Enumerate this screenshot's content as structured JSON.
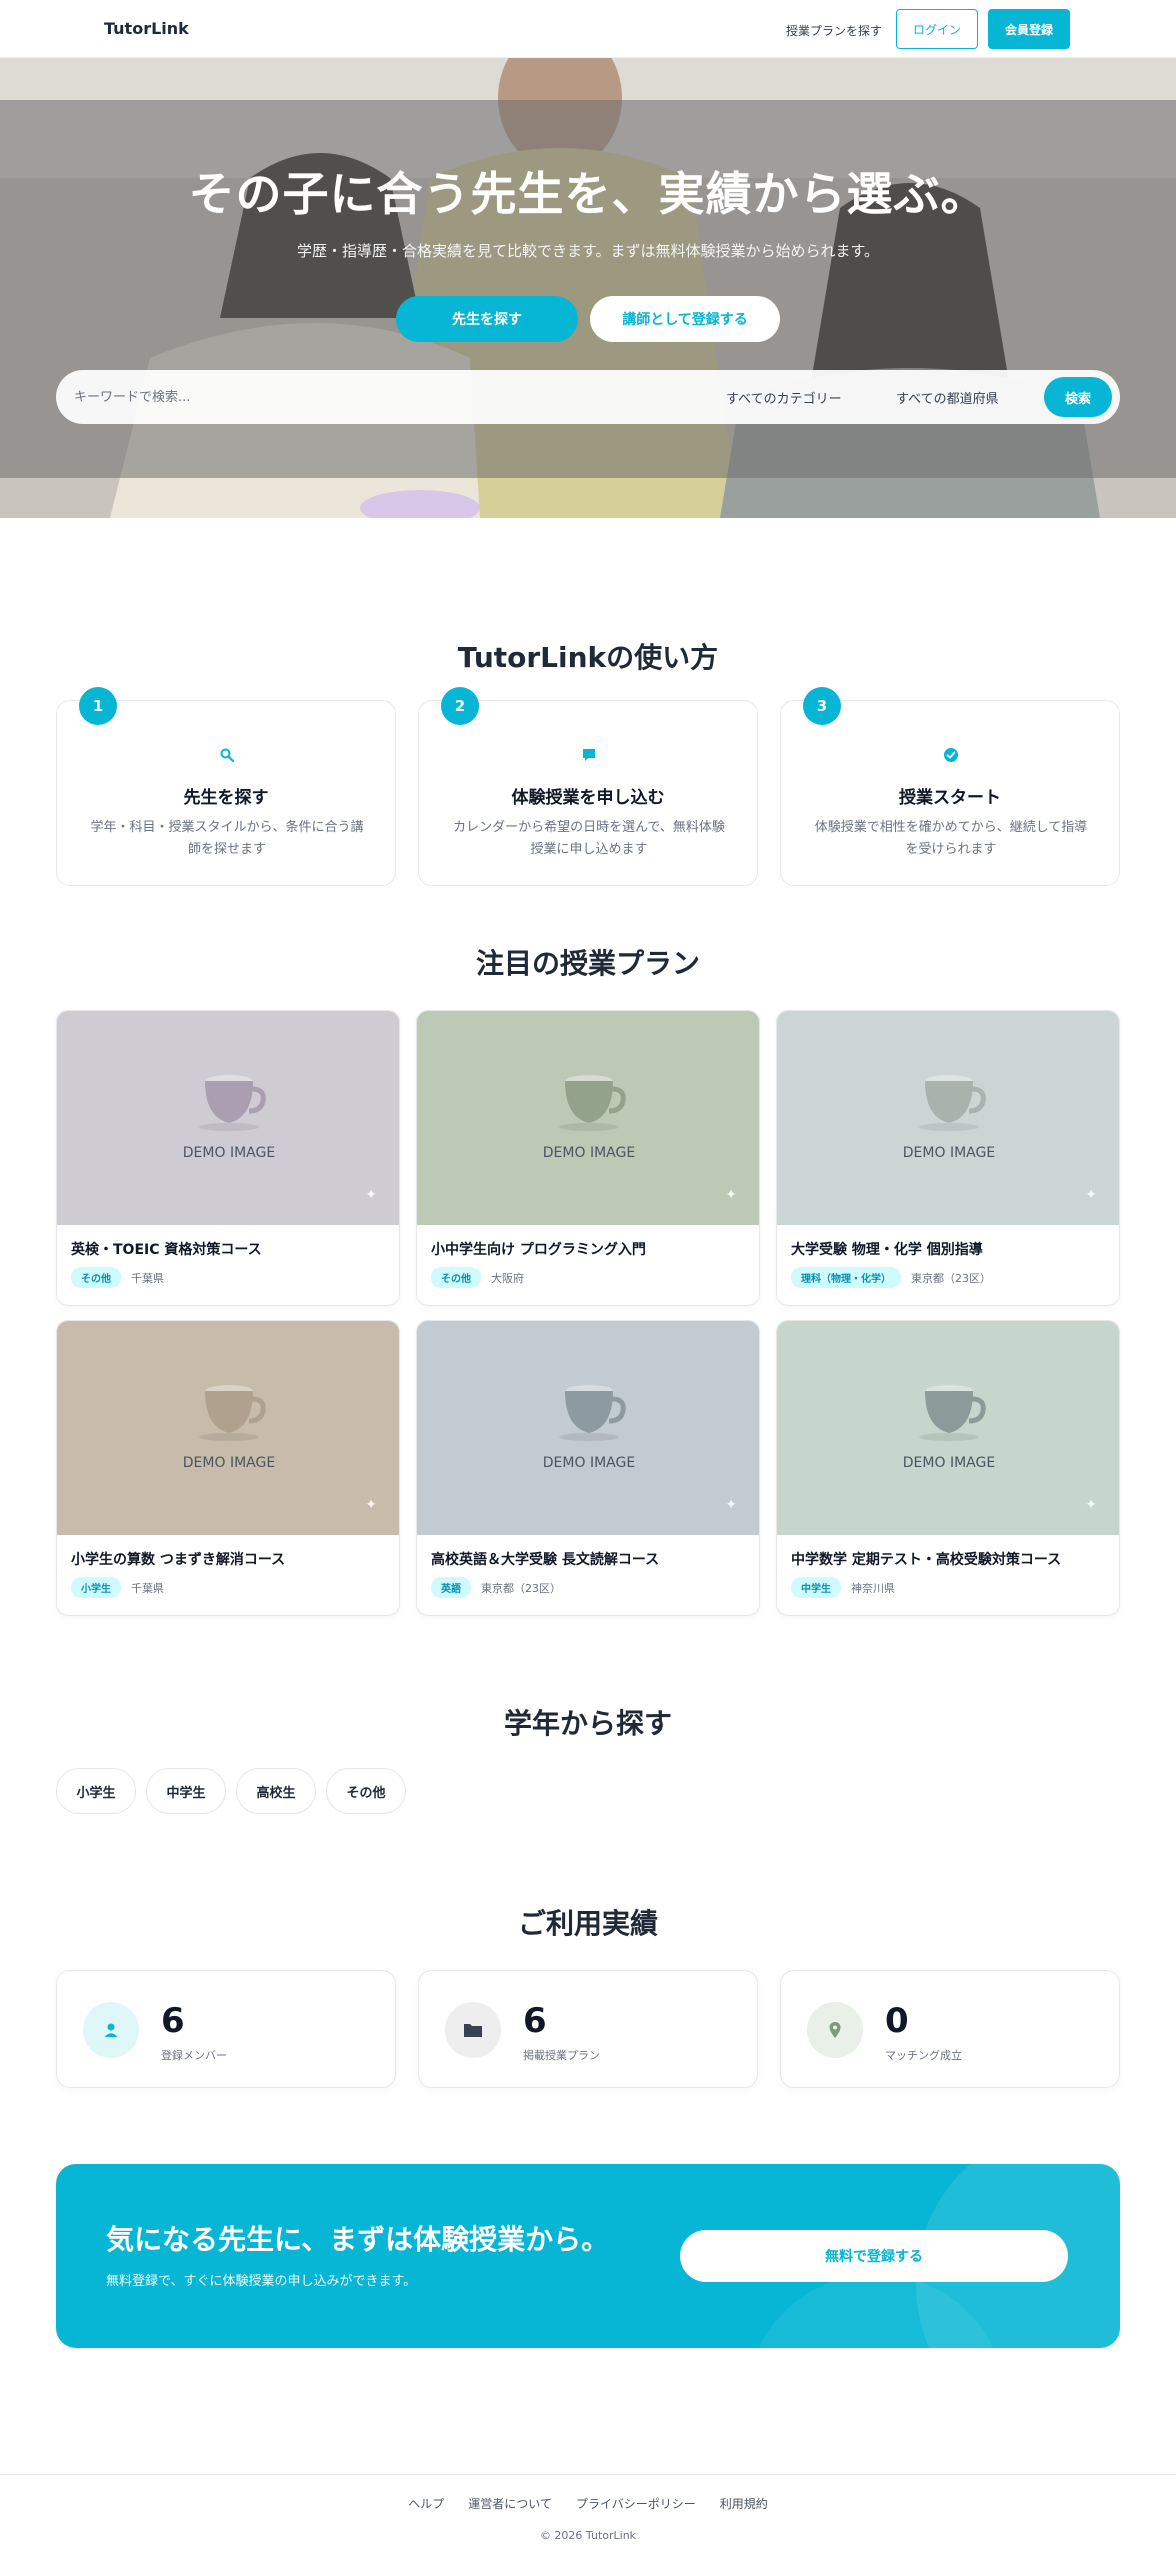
{
  "header": {
    "logo": "TutorLink",
    "nav_link": "授業プランを探す",
    "login_label": "ログイン",
    "signup_label": "会員登録"
  },
  "hero": {
    "title": "その子に合う先生を、実績から選ぶ。",
    "subtitle": "学歴・指導歴・合格実績を見て比較できます。まずは無料体験授業から始められます。",
    "primary_button": "先生を探す",
    "secondary_button": "講師として登録する",
    "search": {
      "placeholder": "キーワードで検索...",
      "category": "すべてのカテゴリー",
      "prefecture": "すべての都道府県",
      "button": "検索"
    }
  },
  "how_to": {
    "title": "TutorLinkの使い方",
    "steps": [
      {
        "number": "1",
        "icon": "search-icon",
        "title": "先生を探す",
        "desc": "学年・科目・授業スタイルから、条件に合う講師を探せます"
      },
      {
        "number": "2",
        "icon": "chat-bubble-icon",
        "title": "体験授業を申し込む",
        "desc": "カレンダーから希望の日時を選んで、無料体験授業に申し込めます"
      },
      {
        "number": "3",
        "icon": "check-circle-icon",
        "title": "授業スタート",
        "desc": "体験授業で相性を確かめてから、継続して指導を受けられます"
      }
    ]
  },
  "plans": {
    "title": "注目の授業プラン",
    "image_label": "DEMO IMAGE",
    "items": [
      {
        "title": "英検・TOEIC 資格対策コース",
        "badge": "その他",
        "location": "千葉県",
        "bg": "#cfcbd3",
        "cup": "#a99fb0"
      },
      {
        "title": "小中学生向け プログラミング入門",
        "badge": "その他",
        "location": "大阪府",
        "bg": "#bcc9b5",
        "cup": "#93a38b"
      },
      {
        "title": "大学受験 物理・化学 個別指導",
        "badge": "理科（物理・化学）",
        "location": "東京都（23区）",
        "bg": "#cbd6d4",
        "cup": "#a9b2ad"
      },
      {
        "title": "小学生の算数 つまずき解消コース",
        "badge": "小学生",
        "location": "千葉県",
        "bg": "#c7bba9",
        "cup": "#b0a18f"
      },
      {
        "title": "高校英語＆大学受験 長文読解コース",
        "badge": "英語",
        "location": "東京都（23区）",
        "bg": "#c2cad2",
        "cup": "#8e9aa2"
      },
      {
        "title": "中学数学 定期テスト・高校受験対策コース",
        "badge": "中学生",
        "location": "神奈川県",
        "bg": "#c6d6cc",
        "cup": "#8d9a9a"
      }
    ]
  },
  "grades": {
    "title": "学年から探す",
    "items": [
      "小学生",
      "中学生",
      "高校生",
      "その他"
    ]
  },
  "stats": {
    "title": "ご利用実績",
    "items": [
      {
        "icon": "user-icon",
        "value": "6",
        "label": "登録メンバー",
        "bg": "#e0f7fa",
        "color": "#06b6d4"
      },
      {
        "icon": "folder-icon",
        "value": "6",
        "label": "掲載授業プラン",
        "bg": "#eeeeee",
        "color": "#374151"
      },
      {
        "icon": "location-pin-icon",
        "value": "0",
        "label": "マッチング成立",
        "bg": "#e8f0e8",
        "color": "#7c9a7c"
      }
    ]
  },
  "cta": {
    "title": "気になる先生に、まずは体験授業から。",
    "subtitle": "無料登録で、すぐに体験授業の申し込みができます。",
    "button": "無料で登録する"
  },
  "footer": {
    "links": [
      "ヘルプ",
      "運営者について",
      "プライバシーポリシー",
      "利用規約"
    ],
    "copyright": "© 2026 TutorLink"
  },
  "colors": {
    "accent": "#06b6d4",
    "text": "#1f2937",
    "muted": "#6b7280"
  }
}
